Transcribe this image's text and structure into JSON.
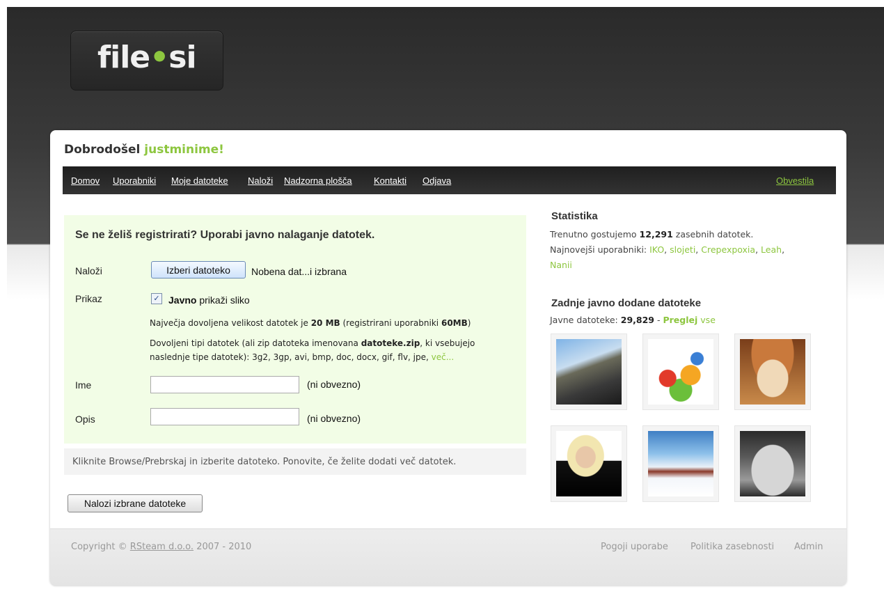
{
  "logo": {
    "text_main": "file",
    "text_dot": "•",
    "text_tld": "si"
  },
  "welcome": {
    "prefix": "Dobrodošel",
    "username": "justminime!"
  },
  "nav": {
    "items": [
      "Domov",
      "Uporabniki",
      "Moje datoteke",
      "Naloži",
      "Nadzorna plošča",
      "Kontakti",
      "Odjava"
    ],
    "right": "Obvestila"
  },
  "upload": {
    "title": "Se ne želiš registrirati? Uporabi javno nalaganje datotek.",
    "upload_label": "Naloži",
    "file_button": "Izberi datoteko",
    "file_status": "Nobena dat...i izbrana",
    "display_label": "Prikaz",
    "public_checked": "✓",
    "public_bold": "Javno",
    "public_rest": "prikaži sliko",
    "size_pre": "Največja dovoljena velikost datotek je",
    "size_value": "20 MB",
    "size_mid": "(registrirani uporabniki",
    "size_reg": "60MB",
    "size_end": ")",
    "types_pre": "Dovoljeni tipi datotek (ali zip datoteka imenovana",
    "types_zip": "datoteke.zip",
    "types_mid": ", ki vsebujejo",
    "types_line2": "naslednje tipe datotek): 3g2, 3gp, avi, bmp, doc, docx, gif, flv, jpe,",
    "types_more": "več...",
    "name_label": "Ime",
    "name_value": "",
    "name_optional": "(ni obvezno)",
    "desc_label": "Opis",
    "desc_value": "",
    "desc_optional": "(ni obvezno)"
  },
  "hint": "Kliknite Browse/Prebrskaj in izberite datoteko. Ponovite, če želite dodati več datotek.",
  "submit_label": "Nalozi izbrane datoteke",
  "stats": {
    "title": "Statistika",
    "hosting_pre": "Trenutno gostujemo",
    "hosting_count": "12,291",
    "hosting_post": "zasebnih datotek.",
    "newest_label": "Najnovejši uporabniki:",
    "newest_users": [
      "IKO",
      "slojeti",
      "Crepexpoxia",
      "Leah",
      "Nanii"
    ]
  },
  "recent": {
    "title": "Zadnje javno dodane datoteke",
    "public_label": "Javne datoteke:",
    "public_count": "29,829",
    "sep": "-",
    "view_bold": "Preglej",
    "view_rest": "vse",
    "thumbs": [
      "car-on-road",
      "flower-bouquet",
      "kitten-with-hat",
      "woman-portrait",
      "snowy-house",
      "silver-car-in-snow"
    ]
  },
  "footer": {
    "copyright_pre": "Copyright ©",
    "company": "RSteam d.o.o.",
    "years": "2007 - 2010",
    "links": [
      "Pogoji uporabe",
      "Politika zasebnosti",
      "Admin"
    ]
  },
  "colors": {
    "accent": "#8dc63f",
    "header_dark": "#2a2a2a",
    "upload_bg": "#f2fde6"
  }
}
